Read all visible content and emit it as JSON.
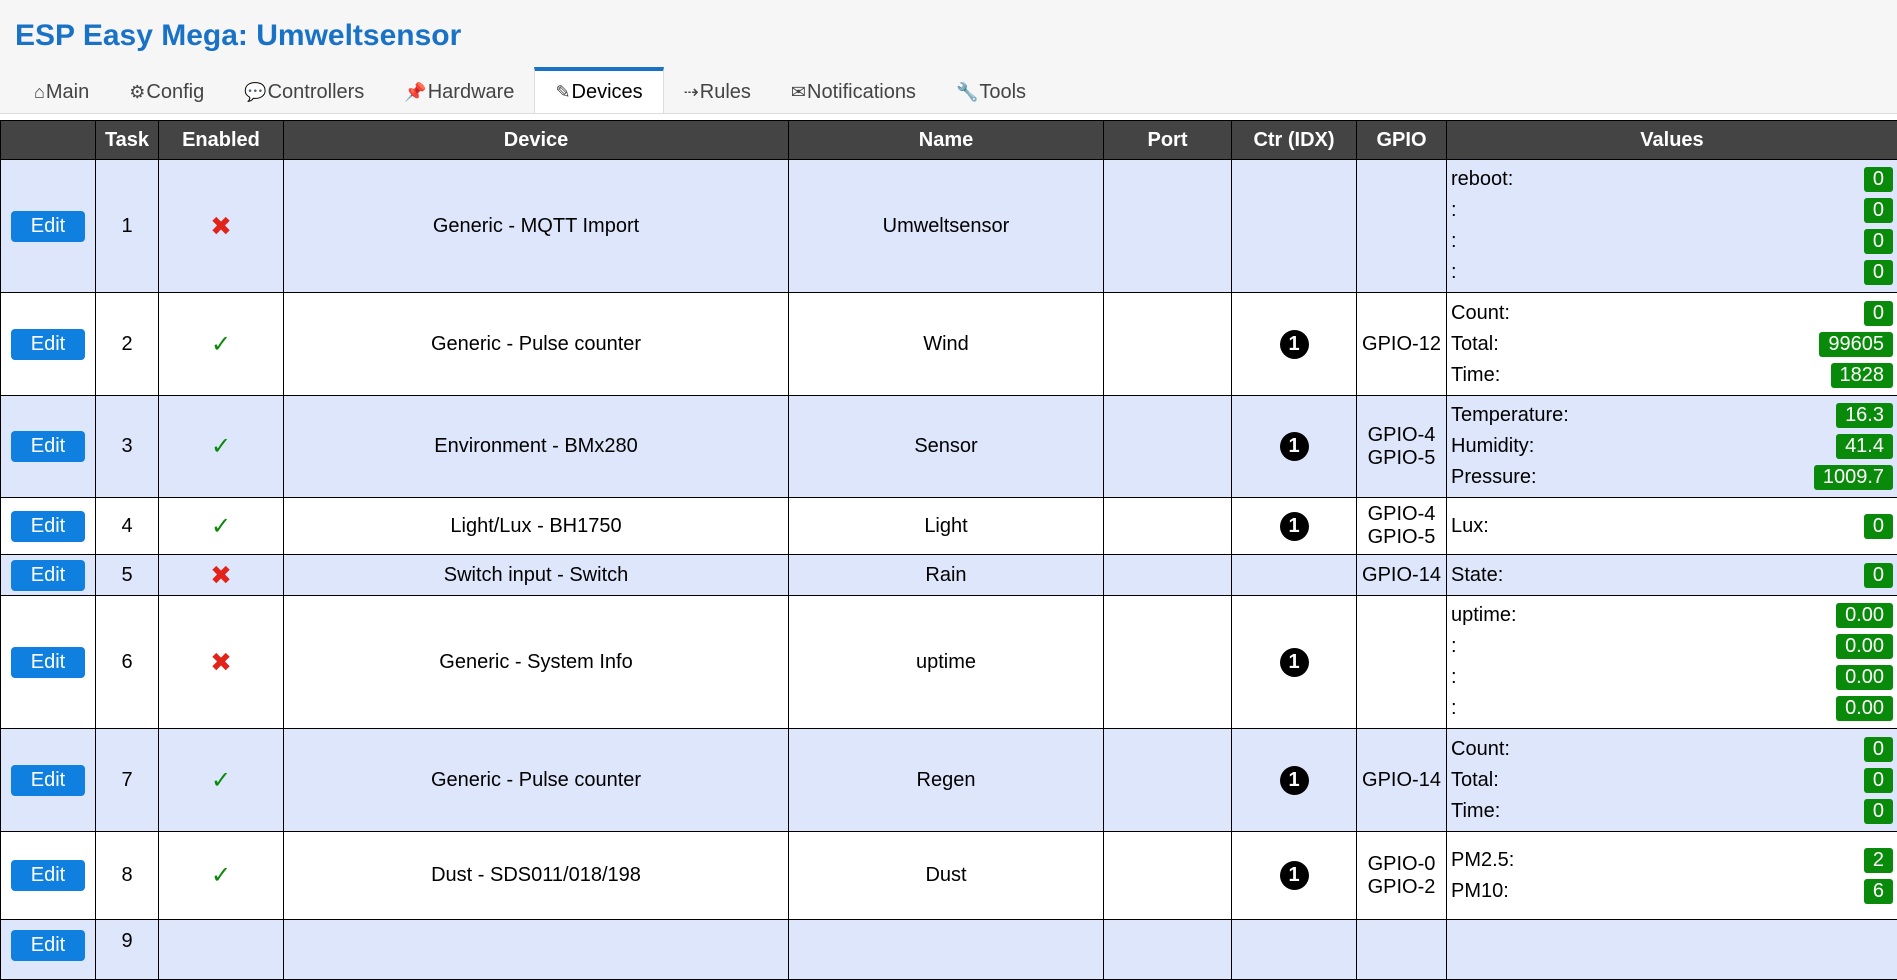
{
  "page": {
    "title": "ESP Easy Mega: Umweltsensor"
  },
  "tabs": [
    {
      "icon": "⌂",
      "label": "Main"
    },
    {
      "icon": "⚙",
      "label": "Config"
    },
    {
      "icon": "💬",
      "label": "Controllers"
    },
    {
      "icon": "📌",
      "label": "Hardware"
    },
    {
      "icon": "✎",
      "label": "Devices",
      "active": true
    },
    {
      "icon": "⇢",
      "label": "Rules"
    },
    {
      "icon": "✉",
      "label": "Notifications"
    },
    {
      "icon": "🔧",
      "label": "Tools"
    }
  ],
  "table": {
    "headers": [
      "",
      "Task",
      "Enabled",
      "Device",
      "Name",
      "Port",
      "Ctr (IDX)",
      "GPIO",
      "Values"
    ],
    "edit_label": "Edit",
    "rows": [
      {
        "task": "1",
        "enabled": false,
        "device": "Generic - MQTT Import",
        "name": "Umweltsensor",
        "port": "",
        "ctr": "",
        "gpio": [],
        "values": [
          {
            "label": "reboot:",
            "value": "0"
          },
          {
            "label": ":",
            "value": "0"
          },
          {
            "label": ":",
            "value": "0"
          },
          {
            "label": ":",
            "value": "0"
          }
        ]
      },
      {
        "task": "2",
        "enabled": true,
        "device": "Generic - Pulse counter",
        "name": "Wind",
        "port": "",
        "ctr": "1",
        "gpio": [
          "GPIO-12"
        ],
        "values": [
          {
            "label": "Count:",
            "value": "0"
          },
          {
            "label": "Total:",
            "value": "99605"
          },
          {
            "label": "Time:",
            "value": "1828"
          }
        ]
      },
      {
        "task": "3",
        "enabled": true,
        "device": "Environment - BMx280",
        "name": "Sensor",
        "port": "",
        "ctr": "1",
        "gpio": [
          "GPIO-4",
          "GPIO-5"
        ],
        "values": [
          {
            "label": "Temperature:",
            "value": "16.3"
          },
          {
            "label": "Humidity:",
            "value": "41.4"
          },
          {
            "label": "Pressure:",
            "value": "1009.7"
          }
        ]
      },
      {
        "task": "4",
        "enabled": true,
        "device": "Light/Lux - BH1750",
        "name": "Light",
        "port": "",
        "ctr": "1",
        "gpio": [
          "GPIO-4",
          "GPIO-5"
        ],
        "values": [
          {
            "label": "Lux:",
            "value": "0"
          }
        ]
      },
      {
        "task": "5",
        "enabled": false,
        "device": "Switch input - Switch",
        "name": "Rain",
        "port": "",
        "ctr": "",
        "gpio": [
          "GPIO-14"
        ],
        "values": [
          {
            "label": "State:",
            "value": "0"
          }
        ]
      },
      {
        "task": "6",
        "enabled": false,
        "device": "Generic - System Info",
        "name": "uptime",
        "port": "",
        "ctr": "1",
        "gpio": [],
        "values": [
          {
            "label": "uptime:",
            "value": "0.00"
          },
          {
            "label": ":",
            "value": "0.00"
          },
          {
            "label": ":",
            "value": "0.00"
          },
          {
            "label": ":",
            "value": "0.00"
          }
        ]
      },
      {
        "task": "7",
        "enabled": true,
        "device": "Generic - Pulse counter",
        "name": "Regen",
        "port": "",
        "ctr": "1",
        "gpio": [
          "GPIO-14"
        ],
        "values": [
          {
            "label": "Count:",
            "value": "0"
          },
          {
            "label": "Total:",
            "value": "0"
          },
          {
            "label": "Time:",
            "value": "0"
          }
        ]
      },
      {
        "task": "8",
        "enabled": true,
        "device": "Dust - SDS011/018/198",
        "name": "Dust",
        "port": "",
        "ctr": "1",
        "gpio": [
          "GPIO-0",
          "GPIO-2"
        ],
        "values": [
          {
            "label": "PM2.5:",
            "value": "2"
          },
          {
            "label": "PM10:",
            "value": "6"
          }
        ]
      },
      {
        "task": "9",
        "enabled": null,
        "device": "",
        "name": "",
        "port": "",
        "ctr": "",
        "gpio": [],
        "values": []
      }
    ]
  },
  "colors": {
    "accent": "#1a72c7",
    "button": "#0f7fe0",
    "value_badge": "#0a8a0a",
    "row_alt": "#dde6fb",
    "header_bg": "#444444"
  }
}
